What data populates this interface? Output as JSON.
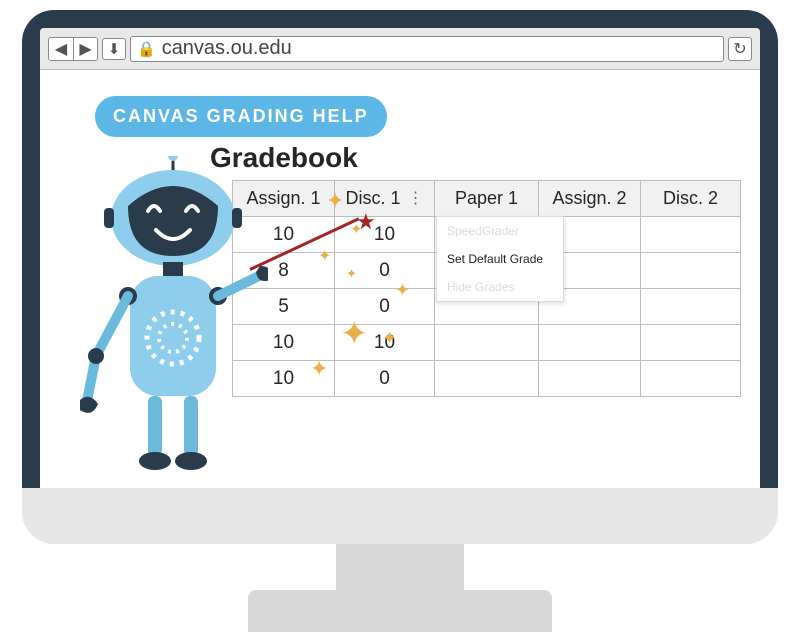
{
  "address": {
    "url": "canvas.ou.edu"
  },
  "badge": {
    "label": "CANVAS GRADING HELP"
  },
  "page": {
    "title": "Gradebook"
  },
  "columns": {
    "c0": "Assign. 1",
    "c1": "Disc. 1",
    "c2": "Paper 1",
    "c3": "Assign. 2",
    "c4": "Disc. 2"
  },
  "rows": [
    {
      "c0": "10",
      "c1": "10",
      "c2": "",
      "c3": "",
      "c4": ""
    },
    {
      "c0": "8",
      "c1": "0",
      "c2": "",
      "c3": "",
      "c4": ""
    },
    {
      "c0": "5",
      "c1": "0",
      "c2": "",
      "c3": "",
      "c4": ""
    },
    {
      "c0": "10",
      "c1": "10",
      "c2": "",
      "c3": "",
      "c4": ""
    },
    {
      "c0": "10",
      "c1": "0",
      "c2": "",
      "c3": "",
      "c4": ""
    }
  ],
  "dropdown": {
    "item0": "SpeedGrader",
    "item1": "Set Default Grade",
    "item2": "Hide Grades"
  },
  "colors": {
    "accent": "#5cb7e6",
    "robot_body": "#8fcdec",
    "robot_dark": "#2a3b4c",
    "sparkle": "#e9b04a",
    "pointer": "#a52323"
  }
}
